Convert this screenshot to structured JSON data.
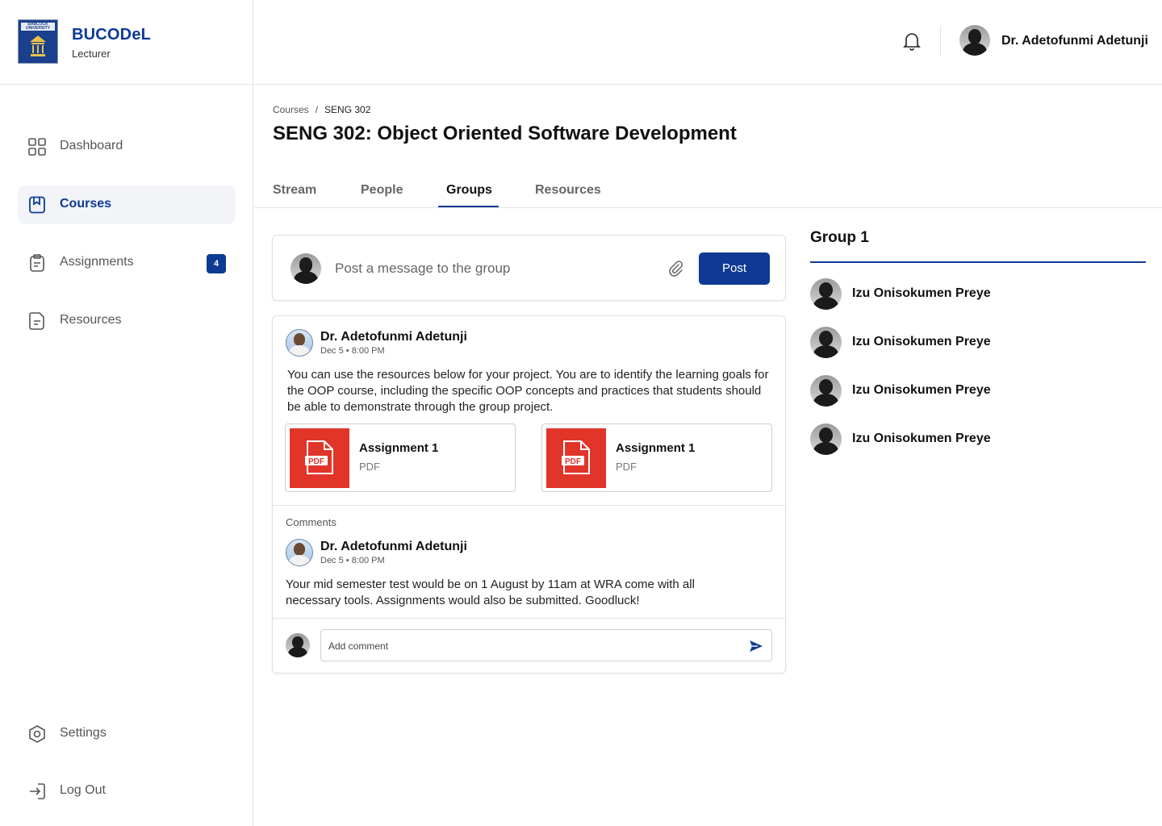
{
  "brand": {
    "name": "BUCODeL",
    "role": "Lecturer",
    "logo_text": "BABCOCK UNIVERSITY"
  },
  "sidebar": {
    "items": [
      {
        "label": "Dashboard",
        "icon": "grid-icon",
        "active": false
      },
      {
        "label": "Courses",
        "icon": "book-icon",
        "active": true
      },
      {
        "label": "Assignments",
        "icon": "clipboard-icon",
        "active": false,
        "badge": "4"
      },
      {
        "label": "Resources",
        "icon": "document-icon",
        "active": false
      }
    ],
    "bottom": [
      {
        "label": "Settings",
        "icon": "settings-icon"
      },
      {
        "label": "Log Out",
        "icon": "logout-icon"
      }
    ]
  },
  "header": {
    "user_name": "Dr. Adetofunmi Adetunji",
    "notifications_icon": "bell-icon"
  },
  "breadcrumb": {
    "root": "Courses",
    "separator": "/",
    "current": "SENG 302"
  },
  "page": {
    "title": "SENG 302: Object Oriented Software Development"
  },
  "tabs": [
    {
      "label": "Stream",
      "active": false
    },
    {
      "label": "People",
      "active": false
    },
    {
      "label": "Groups",
      "active": true
    },
    {
      "label": "Resources",
      "active": false
    }
  ],
  "composer": {
    "placeholder": "Post a message to the group",
    "post_label": "Post"
  },
  "post": {
    "author": "Dr. Adetofunmi Adetunji",
    "time": "Dec 5 • 8:00 PM",
    "text": "You can use the resources below for your project. You are to identify the learning goals for the OOP course, including the specific OOP concepts and practices that students should be able to demonstrate through the group project.",
    "attachments": [
      {
        "name": "Assignment 1",
        "type": "PDF",
        "icon_text": "PDF"
      },
      {
        "name": "Assignment 1",
        "type": "PDF",
        "icon_text": "PDF"
      }
    ],
    "comments_title": "Comments",
    "comment": {
      "author": "Dr. Adetofunmi Adetunji",
      "time": "Dec 5 • 8:00 PM",
      "text": "Your mid semester test would be on 1 August by 11am at WRA come with all necessary tools. Assignments would also be submitted. Goodluck!"
    },
    "comment_placeholder": "Add comment"
  },
  "group": {
    "title": "Group 1",
    "members": [
      "Izu Onisokumen Preye",
      "Izu Onisokumen Preye",
      "Izu Onisokumen Preye",
      "Izu Onisokumen Preye"
    ]
  },
  "colors": {
    "accent": "#0e3a94",
    "pdf": "#e1352a",
    "active_bg": "#f2f4f8"
  }
}
